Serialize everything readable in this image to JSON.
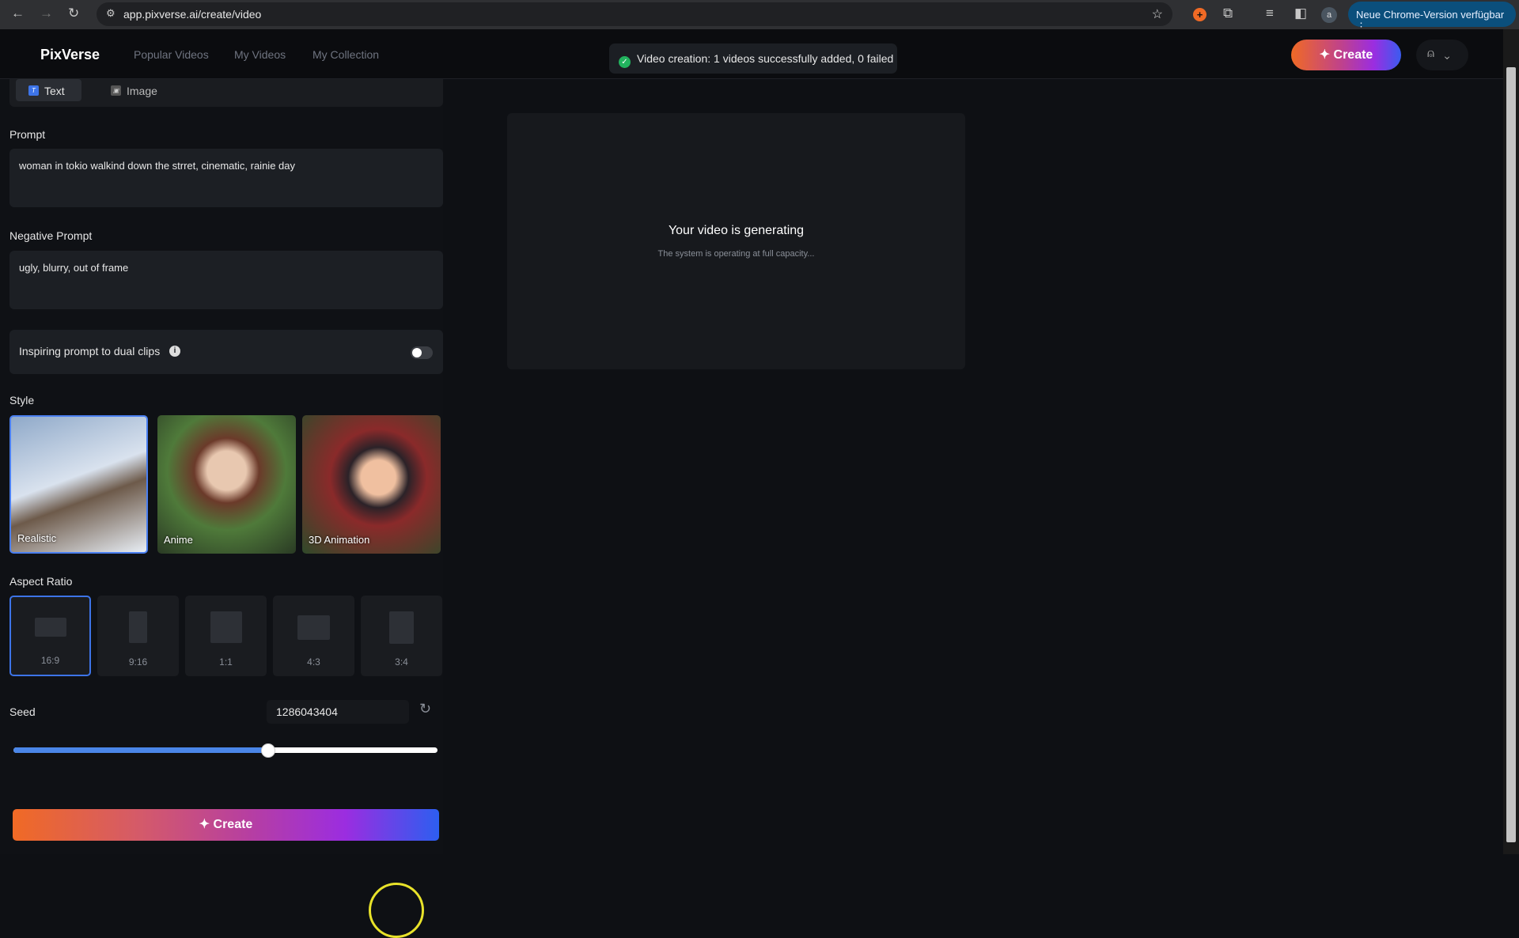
{
  "browser": {
    "url": "app.pixverse.ai/create/video",
    "update_label": "Neue Chrome-Version verfügbar",
    "profile_initial": "a"
  },
  "header": {
    "logo": "PixVerse",
    "nav": [
      "Popular Videos",
      "My Videos",
      "My Collection"
    ],
    "toast": "Video creation: 1 videos successfully added, 0 failed",
    "create_label": "Create"
  },
  "panel": {
    "tabs": [
      {
        "label": "Text",
        "active": true
      },
      {
        "label": "Image",
        "active": false
      }
    ],
    "prompt_label": "Prompt",
    "prompt_value": "woman in tokio walkind down the strret, cinematic, rainie day",
    "negative_label": "Negative Prompt",
    "negative_value": "ugly, blurry, out of frame",
    "dual_label": "Inspiring prompt to dual clips",
    "dual_enabled": false,
    "style_label": "Style",
    "styles": [
      {
        "label": "Realistic",
        "selected": true
      },
      {
        "label": "Anime",
        "selected": false
      },
      {
        "label": "3D Animation",
        "selected": false
      }
    ],
    "aspect_label": "Aspect Ratio",
    "aspects": [
      {
        "label": "16:9",
        "selected": true
      },
      {
        "label": "9:16"
      },
      {
        "label": "1:1"
      },
      {
        "label": "4:3"
      },
      {
        "label": "3:4"
      }
    ],
    "seed_label": "Seed",
    "seed_value": "1286043404",
    "seed_slider_fraction": 0.6,
    "create_label": "Create"
  },
  "preview": {
    "title": "Your video is generating",
    "subtitle": "The system is operating at full capacity..."
  },
  "colors": {
    "accent": "#4a86e8",
    "success": "#22b35e"
  }
}
